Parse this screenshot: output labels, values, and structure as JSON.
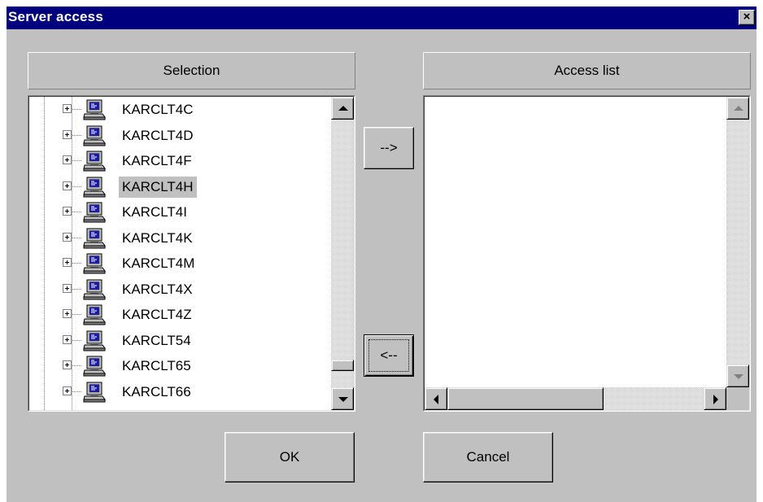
{
  "window": {
    "title": "Server access",
    "close_glyph": "×"
  },
  "selection": {
    "header": "Selection",
    "items": [
      {
        "label": "KARCLT4C",
        "selected": false
      },
      {
        "label": "KARCLT4D",
        "selected": false
      },
      {
        "label": "KARCLT4F",
        "selected": false
      },
      {
        "label": "KARCLT4H",
        "selected": true
      },
      {
        "label": "KARCLT4I",
        "selected": false
      },
      {
        "label": "KARCLT4K",
        "selected": false
      },
      {
        "label": "KARCLT4M",
        "selected": false
      },
      {
        "label": "KARCLT4X",
        "selected": false
      },
      {
        "label": "KARCLT4Z",
        "selected": false
      },
      {
        "label": "KARCLT54",
        "selected": false
      },
      {
        "label": "KARCLT65",
        "selected": false
      },
      {
        "label": "KARCLT66",
        "selected": false
      }
    ],
    "scroll_position": 0.93
  },
  "access_list": {
    "header": "Access list",
    "items": []
  },
  "buttons": {
    "add": "-->",
    "remove": "<--",
    "ok": "OK",
    "cancel": "Cancel"
  },
  "icons": {
    "tree_node": "computer-icon",
    "expander": "plus-expander-icon"
  },
  "colors": {
    "titlebar": "#00007f",
    "face": "#c0c0c0",
    "selected_item_bg": "#c0c0c0"
  }
}
